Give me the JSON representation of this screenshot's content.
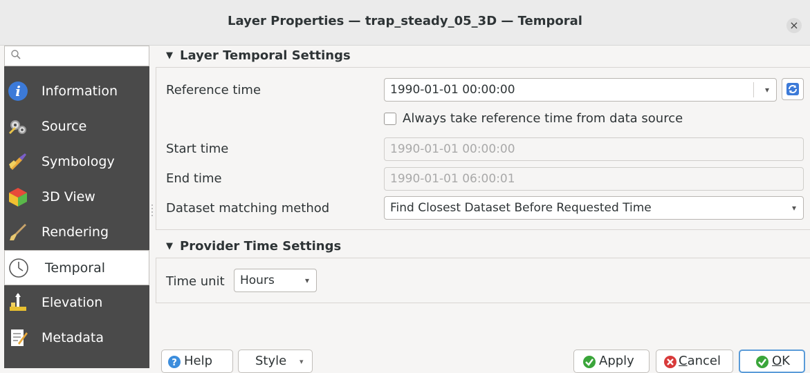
{
  "window": {
    "title": "Layer Properties — trap_steady_05_3D — Temporal",
    "close_glyph": "×"
  },
  "search": {
    "placeholder": "",
    "icon": "search-icon"
  },
  "sidebar": {
    "items": [
      {
        "label": "Information",
        "icon": "information-icon",
        "active": false
      },
      {
        "label": "Source",
        "icon": "source-icon",
        "active": false
      },
      {
        "label": "Symbology",
        "icon": "symbology-icon",
        "active": false
      },
      {
        "label": "3D View",
        "icon": "3d-view-icon",
        "active": false
      },
      {
        "label": "Rendering",
        "icon": "rendering-icon",
        "active": false
      },
      {
        "label": "Temporal",
        "icon": "clock-icon",
        "active": true
      },
      {
        "label": "Elevation",
        "icon": "elevation-icon",
        "active": false
      },
      {
        "label": "Metadata",
        "icon": "metadata-icon",
        "active": false
      }
    ]
  },
  "layer_temporal": {
    "header": "Layer Temporal Settings",
    "reference_time_label": "Reference time",
    "reference_time_value": "1990-01-01 00:00:00",
    "always_reference_label": "Always take reference time from data source",
    "always_reference_checked": false,
    "start_time_label": "Start time",
    "start_time_value": "1990-01-01 00:00:00",
    "end_time_label": "End time",
    "end_time_value": "1990-01-01 06:00:01",
    "matching_label": "Dataset matching method",
    "matching_value": "Find Closest Dataset Before Requested Time"
  },
  "provider_time": {
    "header": "Provider Time Settings",
    "time_unit_label": "Time unit",
    "time_unit_value": "Hours"
  },
  "buttons": {
    "help": "Help",
    "style": "Style",
    "apply": "Apply",
    "cancel_prefix": "C",
    "cancel_rest": "ancel",
    "ok_prefix": "O",
    "ok_rest": "K"
  },
  "colors": {
    "sidebar_bg": "#4a4a4a",
    "accent": "#3c8ddc",
    "apply_green": "#3aa53a",
    "cancel_red": "#d83a3a"
  }
}
